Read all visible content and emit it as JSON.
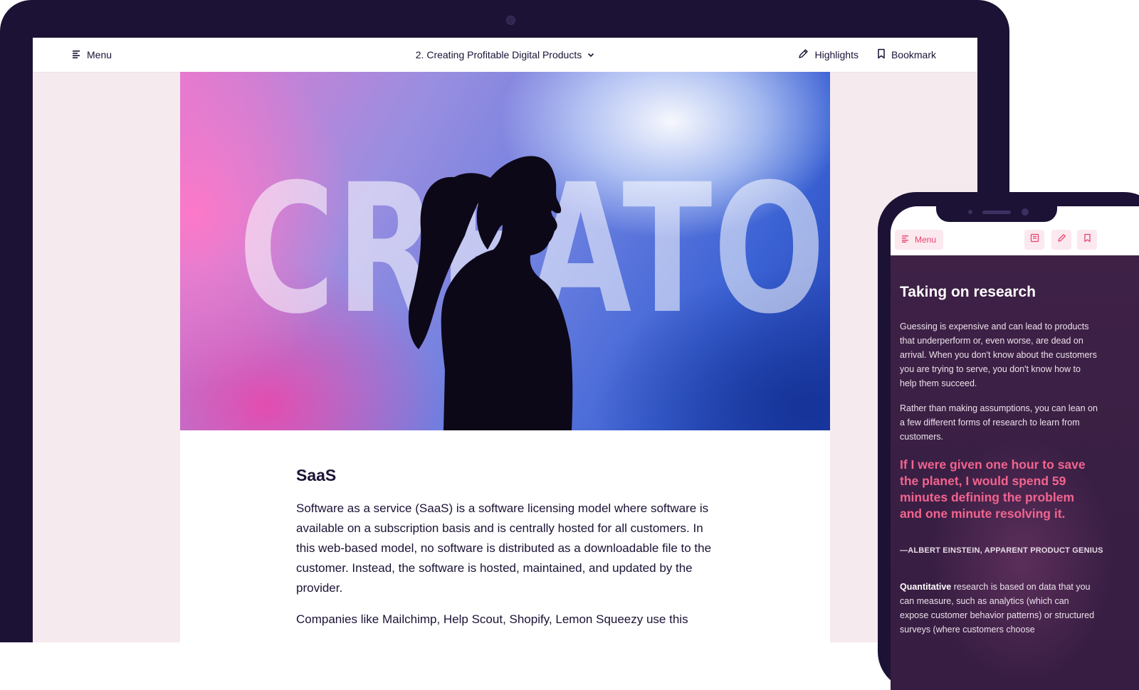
{
  "laptop": {
    "topbar": {
      "menu_label": "Menu",
      "chapter_title": "2. Creating Profitable Digital Products",
      "highlights_label": "Highlights",
      "bookmark_label": "Bookmark"
    },
    "hero": {
      "word": "CREATOR"
    },
    "article": {
      "title": "SaaS",
      "paragraph1": "Software as a service (SaaS) is a software licensing model where software is available on a subscription basis and is centrally hosted for all customers. In this web-based model, no software is distributed as a downloadable file to the customer. Instead, the software is hosted, maintained, and updated by the provider.",
      "paragraph2": "Companies like Mailchimp, Help Scout, Shopify, Lemon Squeezy use this"
    }
  },
  "phone": {
    "menu_label": "Menu",
    "icons": [
      "book-icon",
      "pencil-icon",
      "bookmark-icon"
    ],
    "heading": "Taking on research",
    "paragraph1": "Guessing is expensive and can lead to products that underperform or, even worse, are dead on arrival. When you don't know about the customers you are trying to serve, you don't know how to help them succeed.",
    "paragraph2": "Rather than making assumptions, you can lean on a few different forms of research to learn from customers.",
    "quote": "If I were given one hour to save the planet, I would spend 59 minutes defining the problem and one minute resolving it.",
    "citation": "—ALBERT EINSTEIN, APPARENT PRODUCT GENIUS",
    "paragraph3_bold": "Quantitative",
    "paragraph3_rest": " research is based on data that you can measure, such as analytics (which can expose customer behavior patterns) or structured surveys (where customers choose"
  },
  "colors": {
    "device_frame": "#1c1235",
    "accent_pink": "#e8436e",
    "quote_pink": "#f2648e",
    "page_background": "#f5eaee"
  }
}
